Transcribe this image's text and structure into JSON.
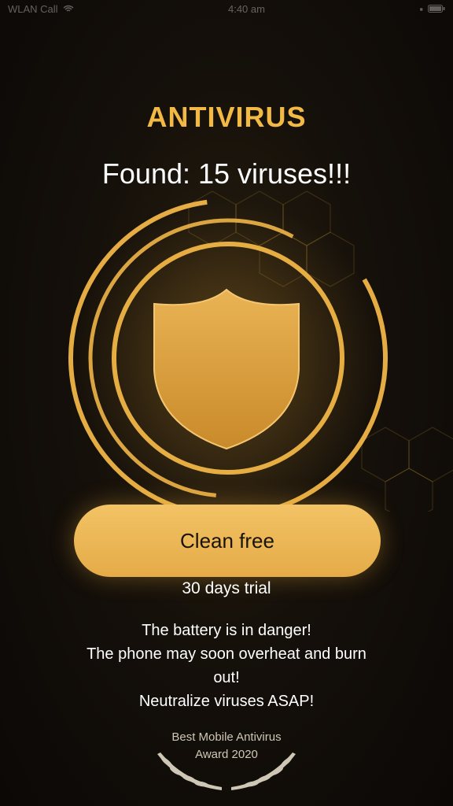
{
  "status_bar": {
    "carrier": "WLAN Call",
    "time": "4:40 am"
  },
  "header": {
    "title": "ANTIVIRUS",
    "found_text": "Found: 15 viruses!!!"
  },
  "main": {
    "clean_button_label": "Clean free",
    "trial_text": "30 days trial",
    "warning_lines": [
      "The battery is in danger!",
      "The phone may soon overheat and burn",
      "out!",
      "Neutralize viruses ASAP!"
    ]
  },
  "award": {
    "line1": "Best Mobile Antivirus",
    "line2": "Award 2020"
  },
  "colors": {
    "accent": "#f3b945",
    "button": "#edb757",
    "background": "#0b0806"
  },
  "icons": [
    "shield-icon",
    "laurel-wreath-icon",
    "wifi-icon",
    "battery-icon"
  ]
}
